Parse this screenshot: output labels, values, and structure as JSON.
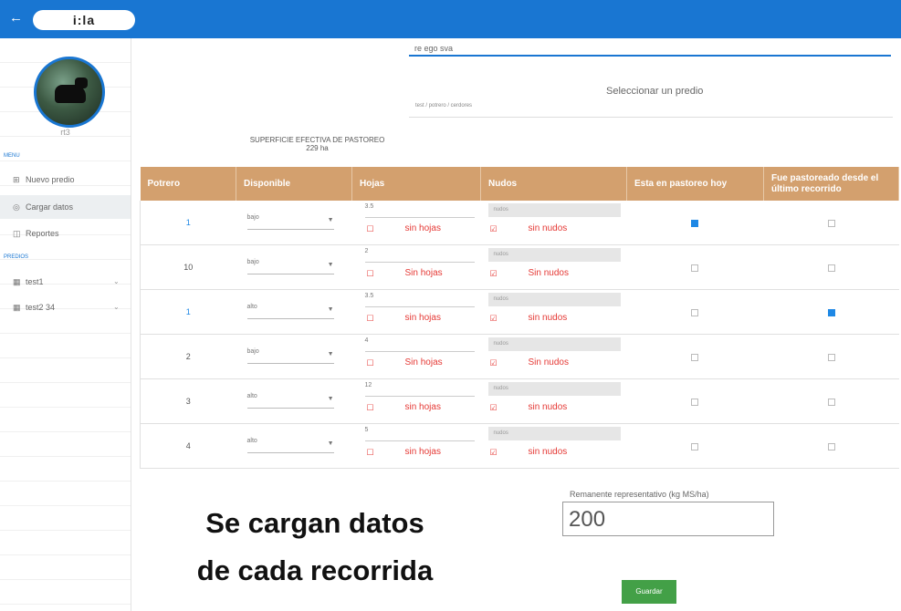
{
  "topbar": {
    "back_icon": "←",
    "logo": "i:la"
  },
  "user": {
    "name": "rt3"
  },
  "sidebar": {
    "section1": "MENU",
    "items": [
      {
        "icon": "⊞",
        "label": "Nuevo predio"
      },
      {
        "icon": "◎",
        "label": "Cargar datos"
      },
      {
        "icon": "◫",
        "label": "Reportes"
      }
    ],
    "section2": "PREDIOS",
    "predios": [
      {
        "icon": "▦",
        "label": "test1"
      },
      {
        "icon": "▦",
        "label": "test2 34"
      }
    ]
  },
  "search": {
    "value": "re ego sva"
  },
  "selector": {
    "title": "Seleccionar un predio",
    "breadcrumb": "test / potrero / cerdores"
  },
  "superficie": {
    "label": "SUPERFICIE EFECTIVA DE PASTOREO",
    "value": "229 ha"
  },
  "table": {
    "headers": [
      "Potrero",
      "Disponible",
      "Hojas",
      "Nudos",
      "Esta en pastoreo hoy",
      "Fue pastoreado desde el último recorrido"
    ],
    "rows": [
      {
        "potrero": "1",
        "link": true,
        "disponible": "bajo",
        "hojas": "3.5",
        "nudos": "nudos",
        "sin_hojas": "sin hojas",
        "sin_nudos": "sin nudos",
        "pastoreo_hoy": true,
        "pastoreado": false
      },
      {
        "potrero": "10",
        "link": false,
        "disponible": "bajo",
        "hojas": "2",
        "nudos": "nudos",
        "sin_hojas": "Sin hojas",
        "sin_nudos": "Sin nudos",
        "pastoreo_hoy": false,
        "pastoreado": false
      },
      {
        "potrero": "1",
        "link": true,
        "disponible": "alto",
        "hojas": "3.5",
        "nudos": "nudos",
        "sin_hojas": "sin hojas",
        "sin_nudos": "sin nudos",
        "pastoreo_hoy": false,
        "pastoreado": true
      },
      {
        "potrero": "2",
        "link": false,
        "disponible": "bajo",
        "hojas": "4",
        "nudos": "nudos",
        "sin_hojas": "Sin hojas",
        "sin_nudos": "Sin nudos",
        "pastoreo_hoy": false,
        "pastoreado": false
      },
      {
        "potrero": "3",
        "link": false,
        "disponible": "alto",
        "hojas": "12",
        "nudos": "nudos",
        "sin_hojas": "sin hojas",
        "sin_nudos": "sin nudos",
        "pastoreo_hoy": false,
        "pastoreado": false
      },
      {
        "potrero": "4",
        "link": false,
        "disponible": "alto",
        "hojas": "5",
        "nudos": "nudos",
        "sin_hojas": "sin hojas",
        "sin_nudos": "sin nudos",
        "pastoreo_hoy": false,
        "pastoreado": false
      }
    ]
  },
  "remanente": {
    "label": "Remanente representativo (kg MS/ha)",
    "value": "200"
  },
  "caption": {
    "line1": "Se cargan datos",
    "line2": "de cada recorrida"
  },
  "save_button": "Guardar"
}
